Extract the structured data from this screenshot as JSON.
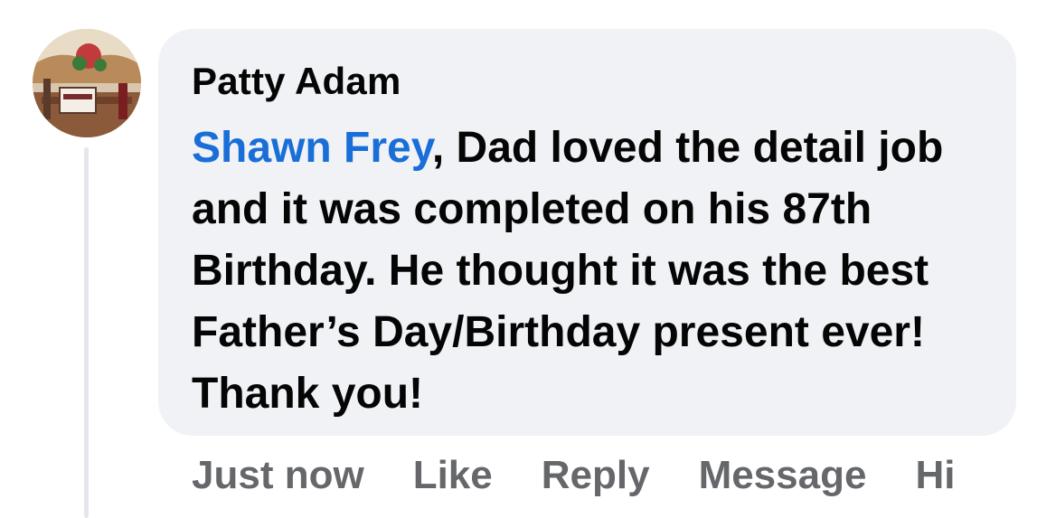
{
  "comment": {
    "author": "Patty Adam",
    "mention": "Shawn Frey",
    "text": ", Dad loved the detail job and it was completed on his 87th Birthday. He thought it was the best Father’s Day/Birthday present ever! Thank you!",
    "mention_color": "#1a6ed8"
  },
  "actions": {
    "timestamp": "Just now",
    "like": "Like",
    "reply": "Reply",
    "message": "Message",
    "hide": "Hi"
  }
}
